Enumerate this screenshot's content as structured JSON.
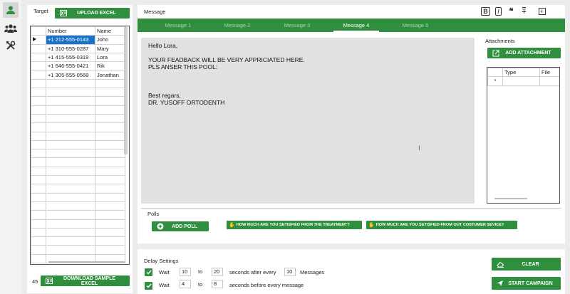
{
  "nav": {
    "items": [
      "user-icon",
      "users-group-icon",
      "tools-icon"
    ]
  },
  "target": {
    "label": "Target",
    "upload_label": "UPLOAD EXCEL",
    "columns": [
      "Number",
      "Name"
    ],
    "rows": [
      {
        "number": "+1 212-555-0143",
        "name": "John"
      },
      {
        "number": "+1 310-555-0287",
        "name": "Mary"
      },
      {
        "number": "+1 415-555-0319",
        "name": "Lora"
      },
      {
        "number": "+1 646-555-0421",
        "name": "Rik"
      },
      {
        "number": "+1 305-555-0568",
        "name": "Jonathan"
      }
    ],
    "count": "45",
    "download_label": "DOWNLOAD SAMPLE EXCEL"
  },
  "message": {
    "label": "Message",
    "format_icons": [
      "bold-icon",
      "italic-icon",
      "quote-icon",
      "strikethrough-icon",
      "add-box-icon"
    ],
    "format_glyphs": [
      "B",
      "I",
      "❝",
      "T",
      "+"
    ],
    "tabs": [
      "Message 1",
      "Message 2",
      "Message 3",
      "Message 4",
      "Message 5"
    ],
    "active_tab": 3,
    "lines": [
      "Hello Lora,",
      "",
      "YOUR FEADBACK WILL BE VERY APPRICIATED HERE.",
      "PLS ANSER THIS POOL:",
      "",
      "",
      "",
      "Best regars,",
      "DR. YUSOFF ORTODENTH"
    ],
    "cursor_glyph": "I"
  },
  "attachments": {
    "label": "Attachments",
    "add_label": "ADD ATTACHMENT",
    "columns": [
      "Type",
      "File"
    ],
    "new_row_marker": "*"
  },
  "polls": {
    "label": "Polls",
    "add_label": "ADD POLL",
    "items": [
      "HOW MUCH ARE YOU SETISFIED FROM THE TREATMENT?",
      "HOW MUCH ARE YOU SETISFIED FROM OUT COSTUMER SEVICE?"
    ]
  },
  "delay": {
    "label": "Delay Settings",
    "row1": {
      "wait": "Wait",
      "from": "10",
      "to_label": "to",
      "to": "20",
      "text": "seconds after every",
      "every": "10",
      "unit": "Messages"
    },
    "row2": {
      "wait": "Wait",
      "from": "4",
      "to_label": "to",
      "to": "8",
      "text": "seconds before every message"
    }
  },
  "actions": {
    "clear_label": "CLEAR",
    "start_label": "START CAMPAIGN"
  }
}
